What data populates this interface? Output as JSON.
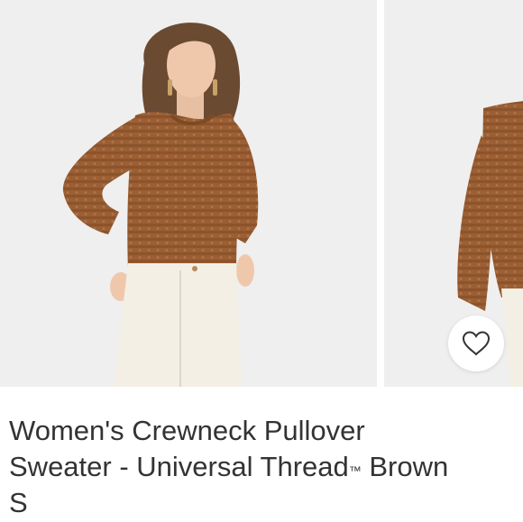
{
  "product": {
    "title_line1": "Women's Crewneck Pullover",
    "title_line2_prefix": "Sweater - Universal Thread",
    "trademark": "™",
    "title_line2_suffix": " Brown",
    "title_line3": "S"
  },
  "gallery": {
    "images": [
      {
        "icon": "model-front-photo"
      },
      {
        "icon": "model-side-photo"
      }
    ],
    "favorite_icon": "heart-outline-icon"
  },
  "colors": {
    "background": "#efefef",
    "sweater": "#9c5f34",
    "pants": "#f3efe4",
    "text": "#333333"
  }
}
